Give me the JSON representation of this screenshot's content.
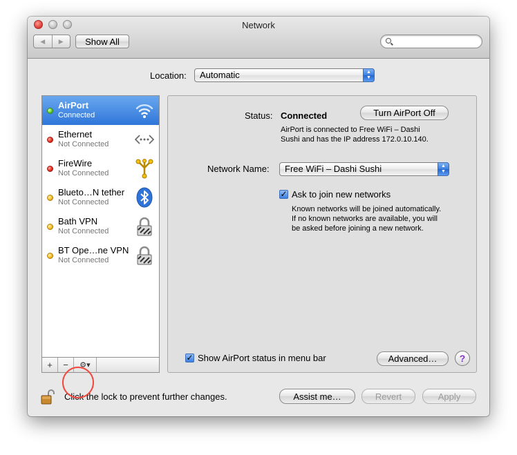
{
  "window": {
    "title": "Network",
    "show_all_label": "Show All",
    "search_placeholder": ""
  },
  "location": {
    "label": "Location:",
    "value": "Automatic"
  },
  "services": [
    {
      "name": "AirPort",
      "status": "Connected",
      "dot": "green",
      "icon": "wifi-icon",
      "selected": true
    },
    {
      "name": "Ethernet",
      "status": "Not Connected",
      "dot": "red",
      "icon": "ethernet-icon"
    },
    {
      "name": "FireWire",
      "status": "Not Connected",
      "dot": "red",
      "icon": "firewire-icon"
    },
    {
      "name": "Blueto…N tether",
      "status": "Not Connected",
      "dot": "yellow",
      "icon": "bluetooth-icon"
    },
    {
      "name": "Bath VPN",
      "status": "Not Connected",
      "dot": "yellow",
      "icon": "vpn-lock-icon"
    },
    {
      "name": "BT Ope…ne VPN",
      "status": "Not Connected",
      "dot": "yellow",
      "icon": "vpn-lock-icon"
    }
  ],
  "sidebar_tools": {
    "add": "+",
    "remove": "−",
    "action": "⚙▾"
  },
  "detail": {
    "status_label": "Status:",
    "status_value": "Connected",
    "turn_off_label": "Turn AirPort Off",
    "status_desc_line1": "AirPort is connected to Free WiFi – Dashi",
    "status_desc_line2": "Sushi and has the IP address 172.0.10.140.",
    "network_name_label": "Network Name:",
    "network_name_value": "Free WiFi – Dashi Sushi",
    "ask_join_label": "Ask to join new networks",
    "ask_join_checked": true,
    "ask_desc_line1": "Known networks will be joined automatically.",
    "ask_desc_line2": "If no known networks are available, you will",
    "ask_desc_line3": "be asked before joining a new network.",
    "show_status_label": "Show AirPort status in menu bar",
    "show_status_checked": true,
    "advanced_label": "Advanced…",
    "help_label": "?"
  },
  "footer": {
    "lock_text": "Click the lock to prevent further changes.",
    "assist_label": "Assist me…",
    "revert_label": "Revert",
    "apply_label": "Apply"
  },
  "colors": {
    "selection": "#3a7fe0",
    "status_green": "#5bd12a",
    "status_red": "#e82d1f",
    "status_yellow": "#f6bf22",
    "annotation": "#f0483f"
  }
}
